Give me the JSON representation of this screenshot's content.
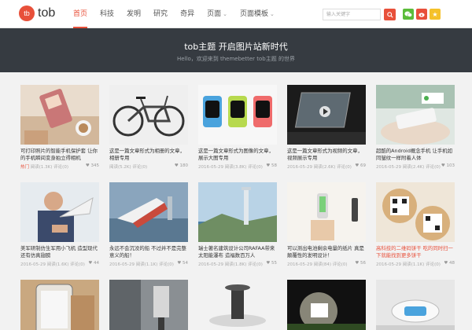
{
  "logo": {
    "badge": "tb",
    "text": "tob"
  },
  "nav": [
    {
      "label": "首页",
      "active": true,
      "dropdown": false
    },
    {
      "label": "科技",
      "active": false,
      "dropdown": false
    },
    {
      "label": "发明",
      "active": false,
      "dropdown": false
    },
    {
      "label": "研究",
      "active": false,
      "dropdown": false
    },
    {
      "label": "奇异",
      "active": false,
      "dropdown": false
    },
    {
      "label": "页面",
      "active": false,
      "dropdown": true
    },
    {
      "label": "页面模板",
      "active": false,
      "dropdown": true
    }
  ],
  "search": {
    "placeholder": "输入关键字"
  },
  "banner": {
    "title": "tob主题 开启图片站新时代",
    "subtitle": "Hello，欢迎来到 themebetter tob主题 的世界"
  },
  "posts": [
    {
      "title": "可打印照片的智能手机保护套 让你的手机瞬间变身拍立得相机",
      "tag": "热门",
      "date": "",
      "views": "阅读(1.3K)",
      "comments": "评论(0)",
      "likes": "345"
    },
    {
      "title": "这是一篇文章形式为相册的文章，相册专用",
      "tag": "",
      "date": "",
      "views": "阅读(5.2K)",
      "comments": "评论(0)",
      "likes": "180"
    },
    {
      "title": "这是一篇文章形式为图像的文章，展示大图专用",
      "tag": "",
      "date": "2016-05-29",
      "views": "阅读(3.8K)",
      "comments": "评论(0)",
      "likes": "58"
    },
    {
      "title": "这是一篇文章形式为视频的文章，视频展示专用",
      "tag": "",
      "date": "2016-05-29",
      "views": "阅读(2.6K)",
      "comments": "评论(0)",
      "likes": "69"
    },
    {
      "title": "超酷的Android概念手机 让手机如同皱纹一样附着人体",
      "tag": "",
      "date": "2016-05-29",
      "views": "阅读(2.4K)",
      "comments": "评论(0)",
      "likes": "103"
    },
    {
      "title": "美军研制仿生军用小飞机 造型现代还有仿真翅膀",
      "tag": "",
      "date": "2016-05-29",
      "views": "阅读(1.6K)",
      "comments": "评论(0)",
      "likes": "44"
    },
    {
      "title": "永远不会沉没的船 不过并不是完整意义的船！",
      "tag": "",
      "date": "2016-05-29",
      "views": "阅读(1.1K)",
      "comments": "评论(0)",
      "likes": "54"
    },
    {
      "title": "瑞士著名建筑设计公司RAFAA带来太阳能瀑布 造福数百万人",
      "tag": "",
      "date": "2016-05-29",
      "views": "阅读(1.8K)",
      "comments": "评论(0)",
      "likes": "55"
    },
    {
      "title": "可以测出电池剩余电量的纸片 真是颠覆性的发明设计！",
      "tag": "",
      "date": "2016-05-29",
      "views": "阅读(84)",
      "comments": "评论(0)",
      "likes": "56"
    },
    {
      "title": "高科技的二维码饼干 吃的同时扫一下就能找到更多饼干",
      "tag": "",
      "date": "2016-05-29",
      "views": "阅读(1.1K)",
      "comments": "评论(0)",
      "likes": "48"
    },
    {
      "title": "",
      "tag": "",
      "date": "",
      "views": "",
      "comments": "",
      "likes": ""
    },
    {
      "title": "",
      "tag": "",
      "date": "",
      "views": "",
      "comments": "",
      "likes": ""
    },
    {
      "title": "",
      "tag": "",
      "date": "",
      "views": "",
      "comments": "",
      "likes": ""
    },
    {
      "title": "",
      "tag": "",
      "date": "",
      "views": "",
      "comments": "",
      "likes": ""
    },
    {
      "title": "",
      "tag": "",
      "date": "",
      "views": "",
      "comments": "",
      "likes": ""
    }
  ],
  "colors": {
    "accent": "#e8503a",
    "banner": "#363b41",
    "wechat": "#5bbc3a",
    "fav": "#f5c12a"
  }
}
